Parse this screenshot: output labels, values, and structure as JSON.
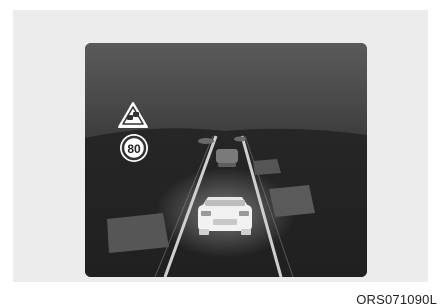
{
  "figure": {
    "code": "ORS071090L",
    "display_bg": "#2b2b2b",
    "speed_sign_value": "80",
    "warning_sign_icon": "traffic-queue-warning-icon"
  }
}
